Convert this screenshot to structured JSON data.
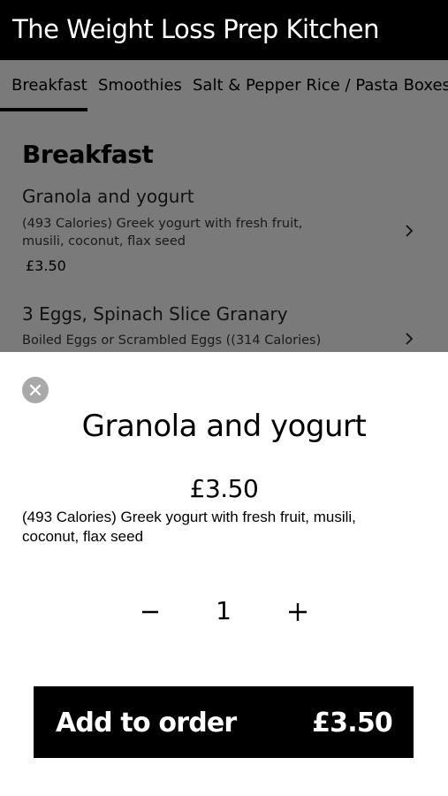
{
  "header": {
    "title": "The Weight Loss Prep Kitchen"
  },
  "tabs": [
    {
      "label": "Breakfast"
    },
    {
      "label": "Smoothies"
    },
    {
      "label": "Salt & Pepper Rice / Pasta Boxes (req"
    }
  ],
  "menu": {
    "section_heading": "Breakfast",
    "items": [
      {
        "name": "Granola and yogurt",
        "description": "(493 Calories) Greek yogurt with fresh fruit, musili, coconut, flax seed",
        "price": "£3.50"
      },
      {
        "name": "3 Eggs, Spinach Slice Granary",
        "description": "Boiled Eggs or Scrambled Eggs ((314 Calories)"
      }
    ]
  },
  "modal": {
    "title": "Granola and yogurt",
    "price": "£3.50",
    "description": "(493 Calories) Greek yogurt with fresh fruit, musili, coconut, flax seed",
    "quantity": "1",
    "add_button_label": "Add to order",
    "add_button_price": "£3.50"
  },
  "icons": {
    "close": "close-icon",
    "chevron": "chevron-right-icon",
    "minus": "minus-icon",
    "plus": "plus-icon"
  },
  "colors": {
    "header_bg": "#000000",
    "overlay_bg": "#7a7a7a",
    "modal_bg": "#ffffff",
    "button_bg": "#000000",
    "close_button_bg": "#a9a9a9"
  }
}
